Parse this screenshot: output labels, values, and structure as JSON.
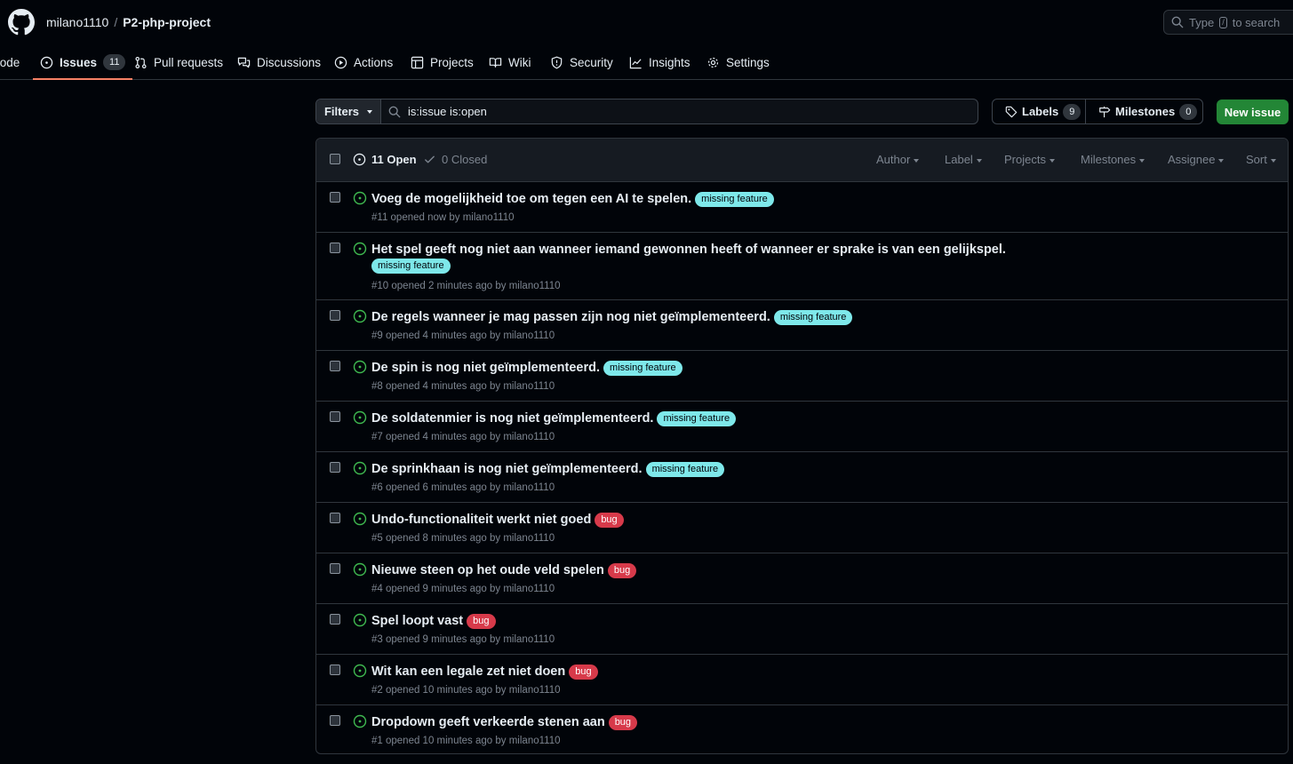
{
  "header": {
    "owner": "milano1110",
    "separator": "/",
    "repo": "P2-php-project",
    "search_prefix": "Type",
    "search_key": "/",
    "search_suffix": "to search"
  },
  "nav": {
    "code": "Code",
    "issues": "Issues",
    "issues_count": "11",
    "pulls": "Pull requests",
    "discussions": "Discussions",
    "actions": "Actions",
    "projects": "Projects",
    "wiki": "Wiki",
    "security": "Security",
    "insights": "Insights",
    "settings": "Settings"
  },
  "toolbar": {
    "filters_label": "Filters",
    "filter_query": "is:issue is:open",
    "labels_label": "Labels",
    "labels_count": "9",
    "milestones_label": "Milestones",
    "milestones_count": "0",
    "new_issue_label": "New issue"
  },
  "list_header": {
    "open_label": "11 Open",
    "closed_label": "0 Closed",
    "author": "Author",
    "label": "Label",
    "projects": "Projects",
    "milestones": "Milestones",
    "assignee": "Assignee",
    "sort": "Sort"
  },
  "colors": {
    "open_icon": "#3fb950",
    "label_missing_feature": "#7ee8ea",
    "label_bug": "#d73a4a",
    "primary_button": "#238636",
    "active_tab_underline": "#f78166"
  },
  "issues": [
    {
      "title": "Voeg de mogelijkheid toe om tegen een AI te spelen.",
      "label": "missing feature",
      "meta": "#11 opened now by milano1110"
    },
    {
      "title": "Het spel geeft nog niet aan wanneer iemand gewonnen heeft of wanneer er sprake is van een gelijkspel.",
      "label": "missing feature",
      "meta": "#10 opened 2 minutes ago by milano1110"
    },
    {
      "title": "De regels wanneer je mag passen zijn nog niet geïmplementeerd.",
      "label": "missing feature",
      "meta": "#9 opened 4 minutes ago by milano1110"
    },
    {
      "title": "De spin is nog niet geïmplementeerd.",
      "label": "missing feature",
      "meta": "#8 opened 4 minutes ago by milano1110"
    },
    {
      "title": "De soldatenmier is nog niet geïmplementeerd.",
      "label": "missing feature",
      "meta": "#7 opened 4 minutes ago by milano1110"
    },
    {
      "title": "De sprinkhaan is nog niet geïmplementeerd.",
      "label": "missing feature",
      "meta": "#6 opened 6 minutes ago by milano1110"
    },
    {
      "title": "Undo-functionaliteit werkt niet goed",
      "label": "bug",
      "meta": "#5 opened 8 minutes ago by milano1110"
    },
    {
      "title": "Nieuwe steen op het oude veld spelen",
      "label": "bug",
      "meta": "#4 opened 9 minutes ago by milano1110"
    },
    {
      "title": "Spel loopt vast",
      "label": "bug",
      "meta": "#3 opened 9 minutes ago by milano1110"
    },
    {
      "title": "Wit kan een legale zet niet doen",
      "label": "bug",
      "meta": "#2 opened 10 minutes ago by milano1110"
    },
    {
      "title": "Dropdown geeft verkeerde stenen aan",
      "label": "bug",
      "meta": "#1 opened 10 minutes ago by milano1110"
    }
  ]
}
